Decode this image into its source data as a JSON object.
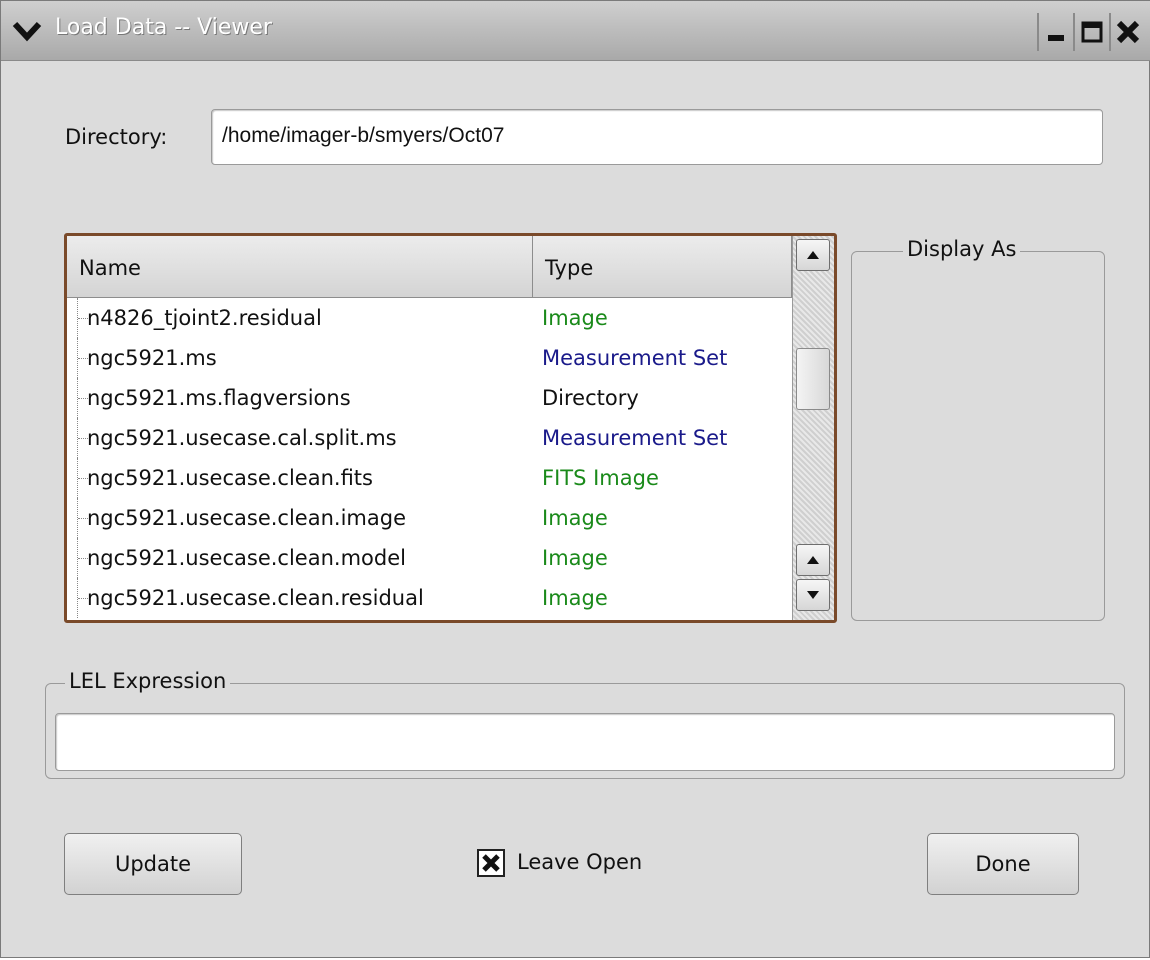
{
  "window": {
    "title": "Load Data -- Viewer",
    "controls": [
      "chevron-down-icon",
      "minimize-icon",
      "maximize-icon",
      "close-icon"
    ]
  },
  "directory": {
    "label": "Directory:",
    "value": "/home/imager-b/smyers/Oct07"
  },
  "file_list": {
    "columns": [
      "Name",
      "Type"
    ],
    "rows": [
      {
        "name": "n4826_tjoint2.residual",
        "type": "Image",
        "color": "#1a8a1a"
      },
      {
        "name": "ngc5921.ms",
        "type": "Measurement Set",
        "color": "#1a1a8a"
      },
      {
        "name": "ngc5921.ms.flagversions",
        "type": "Directory",
        "color": "#111111"
      },
      {
        "name": "ngc5921.usecase.cal.split.ms",
        "type": "Measurement Set",
        "color": "#1a1a8a"
      },
      {
        "name": "ngc5921.usecase.clean.fits",
        "type": "FITS Image",
        "color": "#1a8a1a"
      },
      {
        "name": "ngc5921.usecase.clean.image",
        "type": "Image",
        "color": "#1a8a1a"
      },
      {
        "name": "ngc5921.usecase.clean.model",
        "type": "Image",
        "color": "#1a8a1a"
      },
      {
        "name": "ngc5921.usecase.clean.residual",
        "type": "Image",
        "color": "#1a8a1a"
      }
    ]
  },
  "display_as": {
    "title": "Display As"
  },
  "lel": {
    "title": "LEL Expression",
    "value": ""
  },
  "buttons": {
    "update": "Update",
    "done": "Done"
  },
  "leave_open": {
    "label": "Leave Open",
    "checked": true
  }
}
